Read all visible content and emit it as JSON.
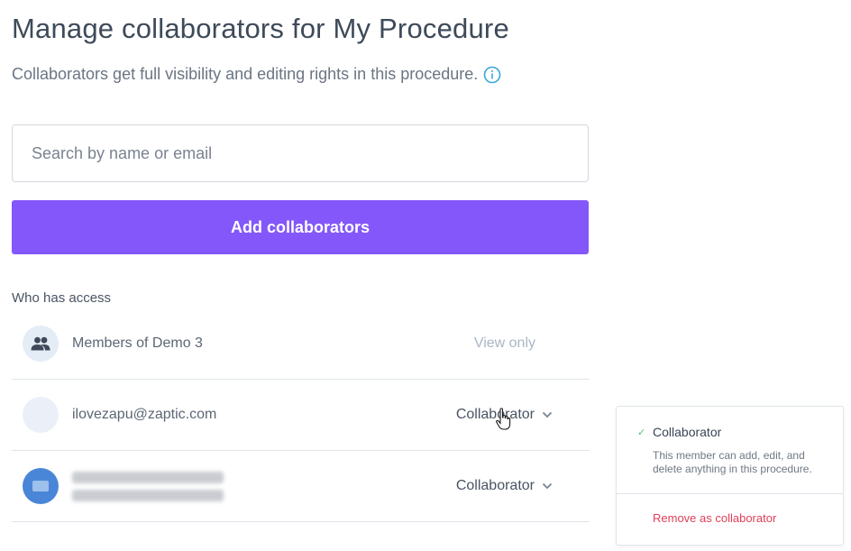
{
  "header": {
    "title": "Manage collaborators for My Procedure",
    "subtitle": "Collaborators get full visibility and editing rights in this procedure."
  },
  "search": {
    "placeholder": "Search by name or email",
    "value": ""
  },
  "add_button": {
    "label": "Add collaborators"
  },
  "access": {
    "label": "Who has access",
    "rows": [
      {
        "name": "Members of Demo 3",
        "role": "View only",
        "avatar": "group-icon"
      },
      {
        "name": "ilovezapu@zaptic.com",
        "role": "Collaborator",
        "avatar": "blank"
      },
      {
        "name": "",
        "role": "Collaborator",
        "avatar": "photo"
      }
    ]
  },
  "dropdown": {
    "option_title": "Collaborator",
    "option_desc": "This member can add, edit, and delete anything in this procedure.",
    "remove_label": "Remove as collaborator"
  },
  "colors": {
    "accent": "#8357fa",
    "danger": "#e0405a",
    "success": "#4fbf8b",
    "info": "#3aa7d9"
  }
}
